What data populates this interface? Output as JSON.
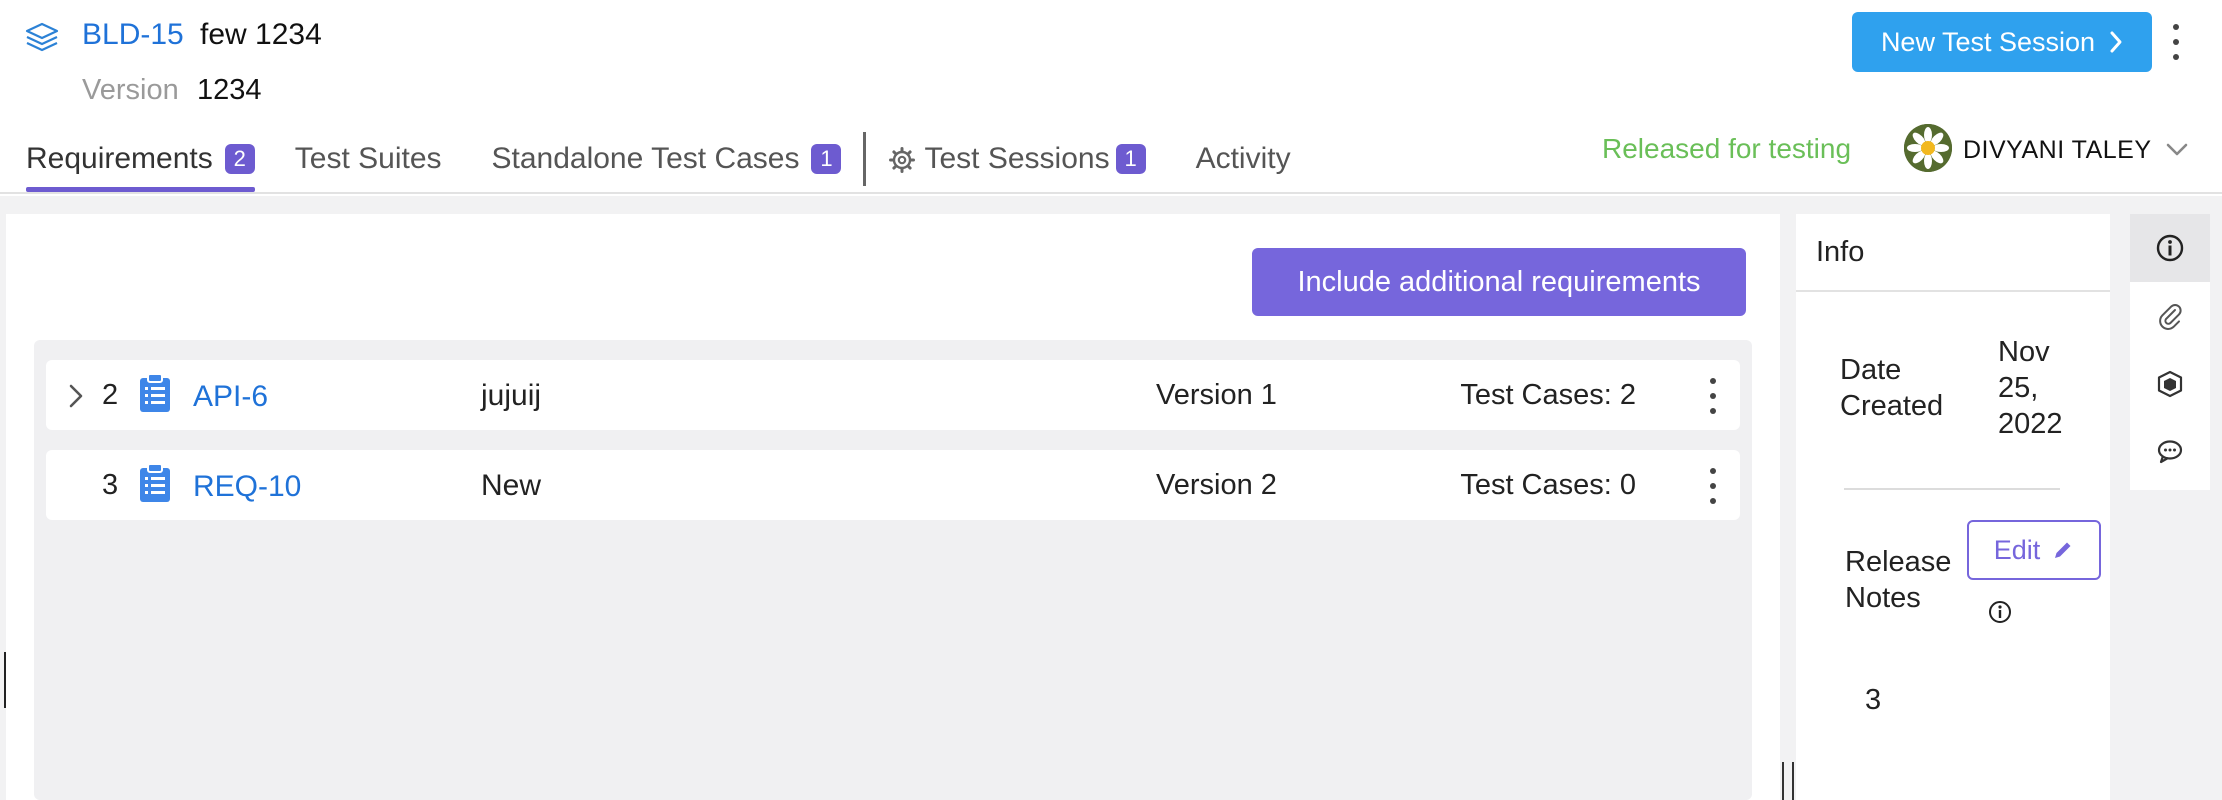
{
  "build": {
    "id": "BLD-15",
    "name": "few 1234",
    "version_label": "Version",
    "version_value": "1234",
    "icon": "layers-icon"
  },
  "actions": {
    "new_session_label": "New Test Session",
    "more_icon": "kebab-vertical-icon"
  },
  "tabs": [
    {
      "label": "Requirements",
      "badge": "2",
      "active": true
    },
    {
      "label": "Test Suites",
      "badge": null,
      "active": false
    },
    {
      "label": "Standalone Test Cases",
      "badge": "1",
      "active": false
    },
    {
      "label": "Test Sessions",
      "badge": "1",
      "active": false,
      "icon": "gear-icon"
    },
    {
      "label": "Activity",
      "badge": null,
      "active": false
    }
  ],
  "status": {
    "text": "Released for testing",
    "color": "#6abf58"
  },
  "user": {
    "name": "DIVYANI TALEY",
    "avatar_icon": "daisy-avatar"
  },
  "requirements": {
    "include_button_label": "Include additional requirements",
    "rows": [
      {
        "number": "2",
        "id": "API-6",
        "title": "jujuij",
        "version": "Version 1",
        "test_cases": "Test Cases: 2",
        "expandable": true
      },
      {
        "number": "3",
        "id": "REQ-10",
        "title": "New",
        "version": "Version 2",
        "test_cases": "Test Cases: 0",
        "expandable": false
      }
    ]
  },
  "info": {
    "title": "Info",
    "date_created_label": "Date Created",
    "date_created_value": "Nov 25, 2022",
    "release_notes_label": "Release Notes",
    "edit_label": "Edit",
    "release_notes_value": "3"
  },
  "rail": [
    {
      "icon": "info-icon",
      "active": true
    },
    {
      "icon": "paperclip-icon",
      "active": false
    },
    {
      "icon": "box-icon",
      "active": false
    },
    {
      "icon": "comments-icon",
      "active": false
    }
  ],
  "colors": {
    "accent": "#6d5bd0",
    "primary_button": "#2fa1ee",
    "link": "#1f72d8"
  }
}
